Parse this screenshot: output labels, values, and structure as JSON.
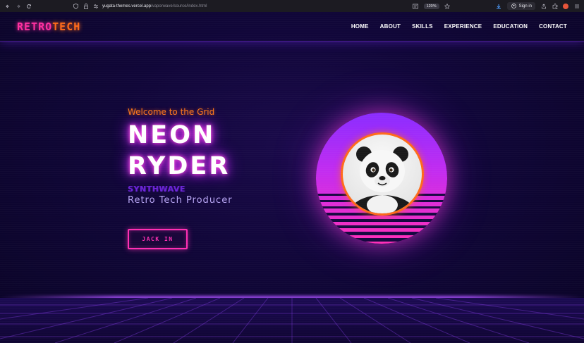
{
  "browser": {
    "url_host": "yugata-themes.vercel.app",
    "url_path": "/vaporwave/source/index.html",
    "zoom": "120%",
    "sign_in_label": "Sign in"
  },
  "site": {
    "logo_part1": "RETRO",
    "logo_part2": "TECH",
    "nav": [
      "HOME",
      "ABOUT",
      "SKILLS",
      "EXPERIENCE",
      "EDUCATION",
      "CONTACT"
    ]
  },
  "hero": {
    "welcome": "Welcome to the Grid",
    "name_line1": "NEON",
    "name_line2": "RYDER",
    "subtitle": "SYNTHWAVE",
    "role": "Retro Tech Producer",
    "cta_label": "JACK IN"
  },
  "colors": {
    "background": "#0e0630",
    "accent_pink": "#ff2fb4",
    "accent_orange": "#ff7a18",
    "sun_top": "#8a2cff",
    "sun_bottom": "#ff2fb8"
  },
  "icons": {
    "back": "arrow-left-icon",
    "forward": "arrow-right-icon",
    "reload": "reload-icon",
    "shield": "shield-icon",
    "lock": "lock-icon",
    "star": "bookmark-star-icon",
    "download": "download-icon",
    "account": "account-icon",
    "extensions": "puzzle-icon"
  }
}
